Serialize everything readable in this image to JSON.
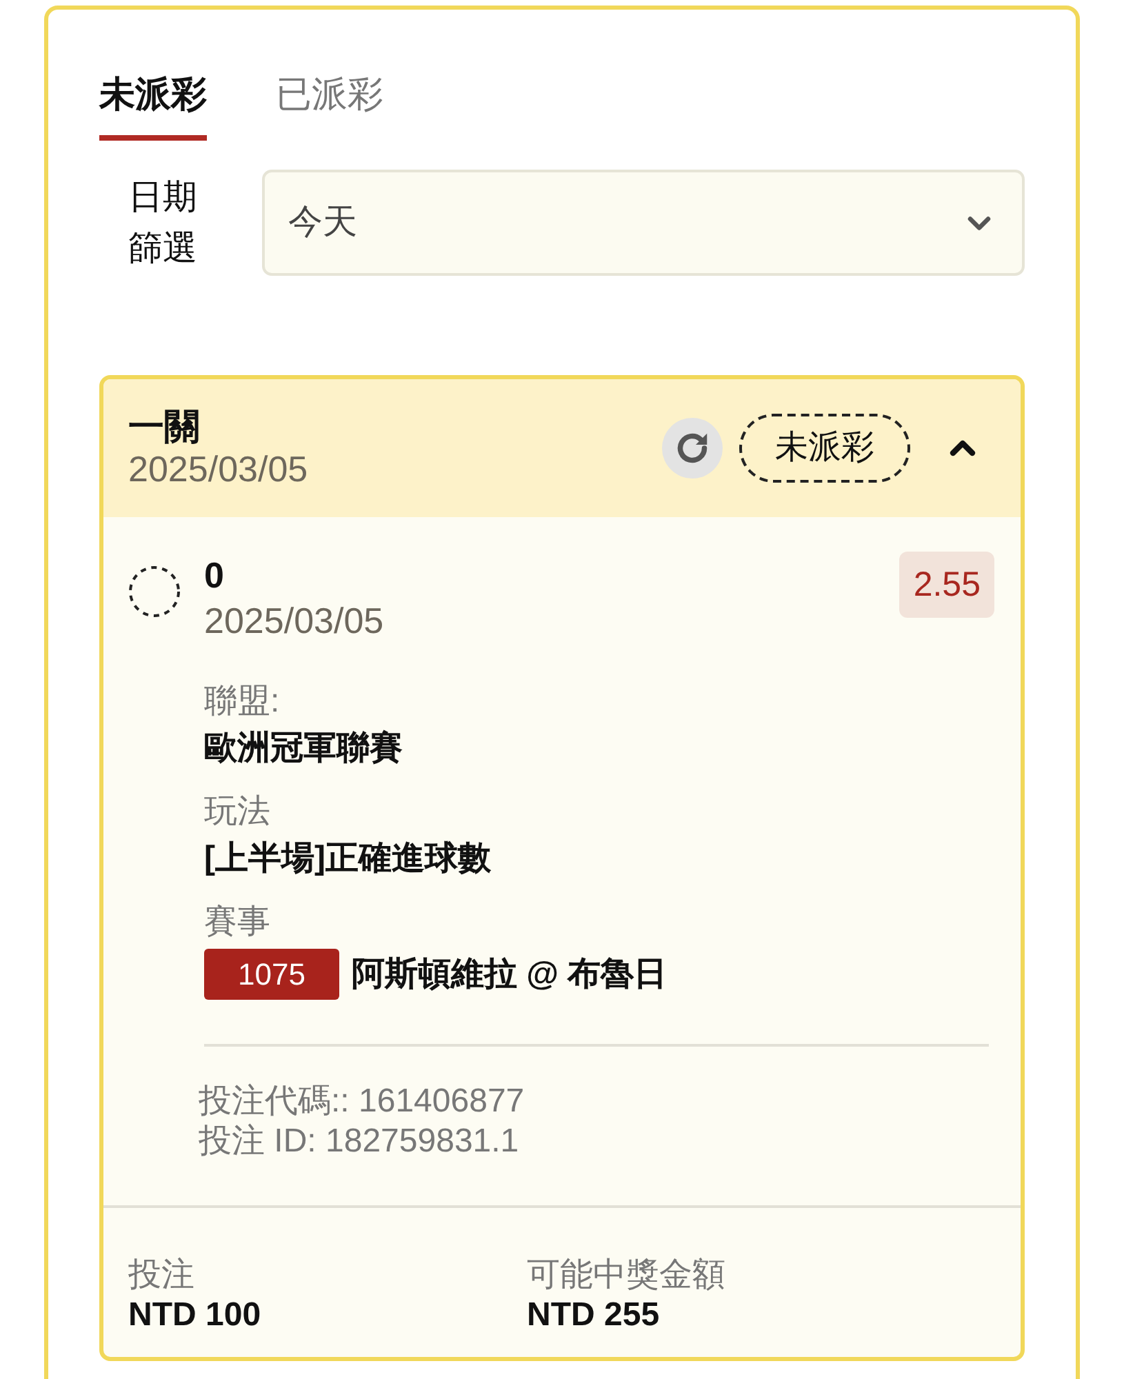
{
  "tabs": [
    {
      "label": "未派彩",
      "selected": true
    },
    {
      "label": "已派彩",
      "selected": false
    }
  ],
  "date_filter": {
    "label": "日期篩選",
    "value": "今天"
  },
  "bet": {
    "type": "一關",
    "date": "2025/03/05",
    "status": "未派彩",
    "expanded": true,
    "selection": {
      "name": "0",
      "date": "2025/03/05",
      "odds": "2.55"
    },
    "details": [
      {
        "kind": "text",
        "label": "聯盟:",
        "value": "歐洲冠軍聯賽"
      },
      {
        "kind": "text",
        "label": "玩法",
        "value": "[上半場]正確進球數"
      },
      {
        "kind": "match",
        "label": "賽事",
        "code": "1075",
        "value": "阿斯頓維拉 @ 布魯日"
      }
    ],
    "codes": [
      "投注代碼:: 161406877",
      "投注 ID: 182759831.1"
    ],
    "summary": [
      {
        "label": "投注",
        "value": "NTD 100"
      },
      {
        "label": "可能中獎金額",
        "value": "NTD 255"
      }
    ]
  }
}
